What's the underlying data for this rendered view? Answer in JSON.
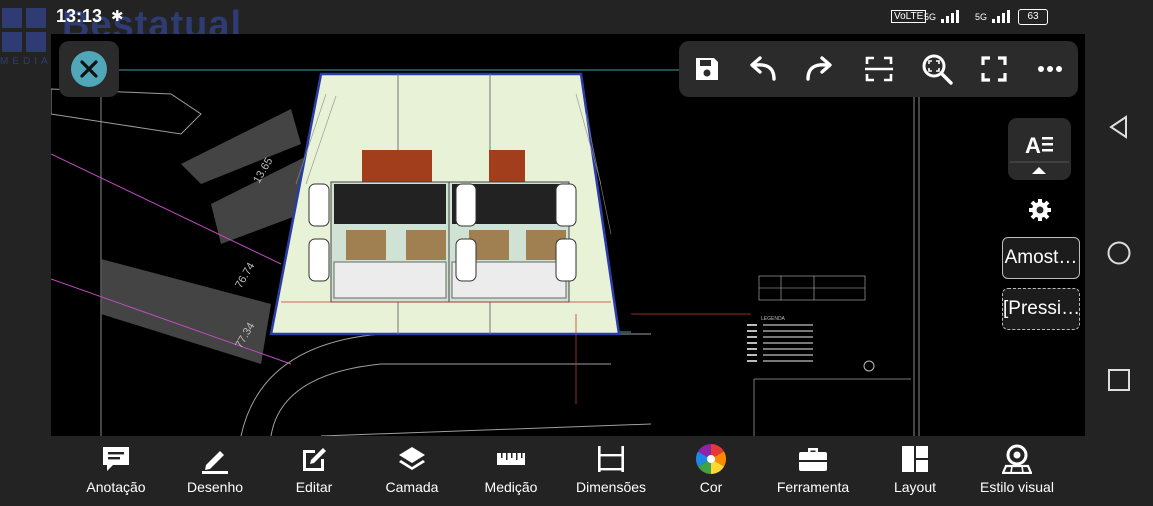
{
  "status_bar": {
    "time": "13:13",
    "bluetooth_icon": "bluetooth-icon",
    "volte": "VoLTE",
    "signal1": "5G",
    "signal2": "5G",
    "battery": "63"
  },
  "watermark": {
    "brand": "Bestatual",
    "tagline": "MEDIAÇÃO IMOBILIÁRIA"
  },
  "drawing": {
    "dimensions": [
      "13.65",
      "76.74",
      "77.34"
    ],
    "legend_title": "LEGENDA"
  },
  "top_toolbar": {
    "icons": [
      "save-icon",
      "undo-icon",
      "redo-icon",
      "select-region-icon",
      "zoom-fit-icon",
      "fullscreen-icon",
      "more-icon"
    ]
  },
  "right_panel": {
    "text_style_icon": "text-style-icon",
    "chip_sample": "Amost…",
    "chip_press": "[Pressi…"
  },
  "bottom_toolbar": {
    "items": [
      {
        "label": "Anotação",
        "icon": "annotation-icon"
      },
      {
        "label": "Desenho",
        "icon": "pencil-icon"
      },
      {
        "label": "Editar",
        "icon": "edit-icon"
      },
      {
        "label": "Camada",
        "icon": "layers-icon"
      },
      {
        "label": "Medição",
        "icon": "ruler-icon"
      },
      {
        "label": "Dimensões",
        "icon": "dimension-icon"
      },
      {
        "label": "Cor",
        "icon": "color-wheel-icon"
      },
      {
        "label": "Ferramenta",
        "icon": "toolbox-icon"
      },
      {
        "label": "Layout",
        "icon": "layout-icon"
      },
      {
        "label": "Estilo visual",
        "icon": "visual-style-icon"
      }
    ]
  },
  "colors": {
    "accent": "#4fa7b8",
    "toolbar_bg": "#2b2b2b",
    "canvas_bg": "#000000"
  }
}
